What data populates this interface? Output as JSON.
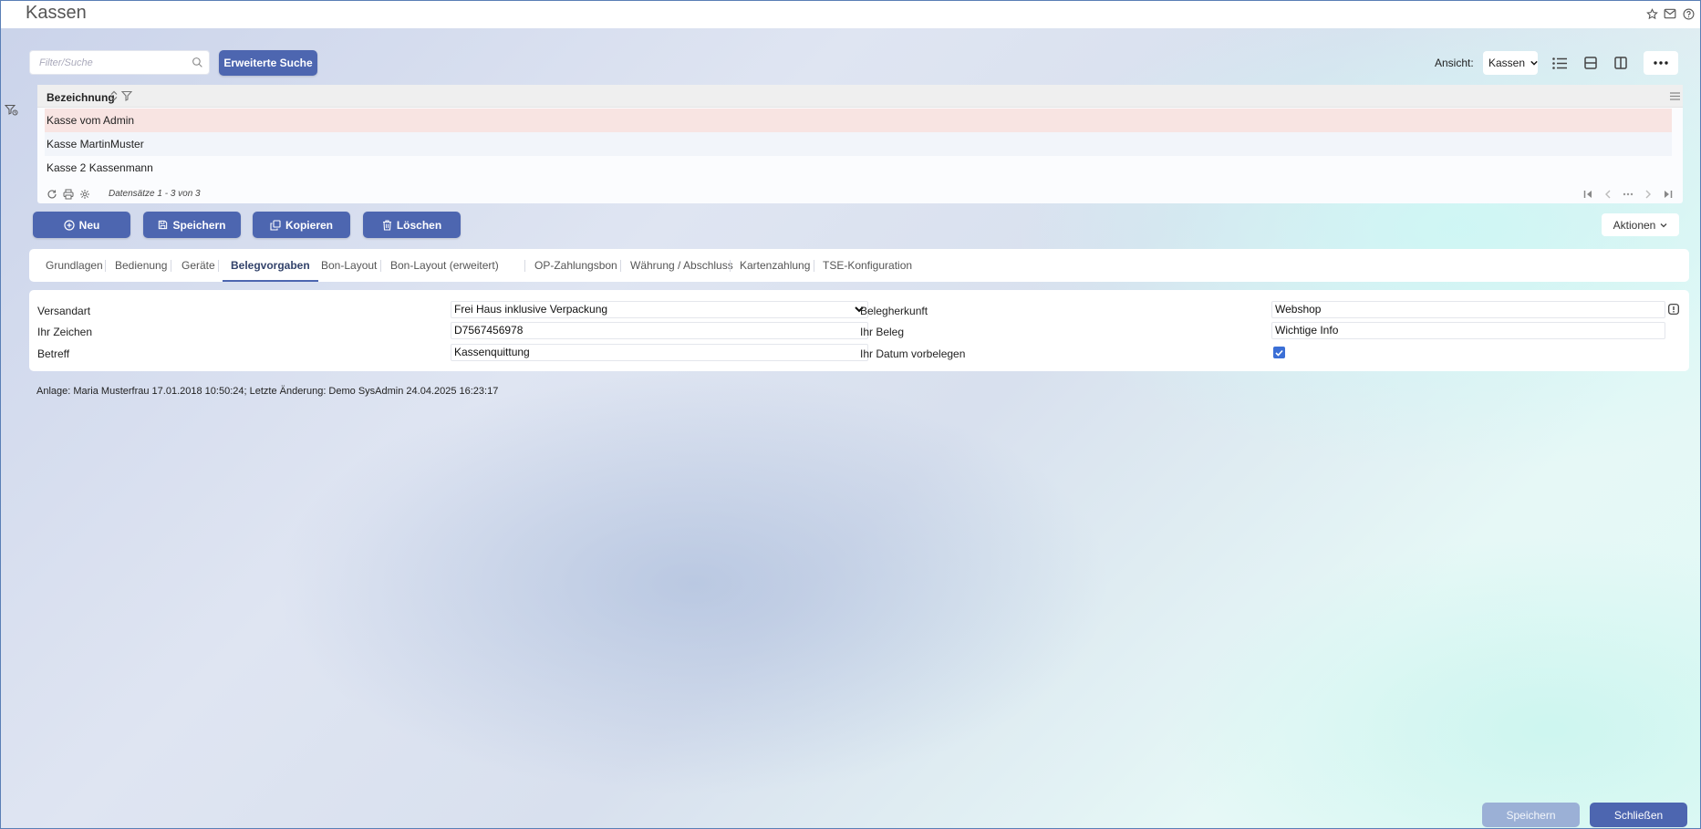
{
  "header": {
    "title": "Kassen"
  },
  "search": {
    "placeholder": "Filter/Suche",
    "extended_label": "Erweiterte Suche"
  },
  "view": {
    "label": "Ansicht:",
    "selected": "Kassen"
  },
  "grid": {
    "column": "Bezeichnung",
    "rows": [
      {
        "name": "Kasse vom Admin",
        "selected": true
      },
      {
        "name": "Kasse MartinMuster",
        "selected": false
      },
      {
        "name": "Kasse 2 Kassenmann",
        "selected": false
      }
    ],
    "record_count": "Datensätze 1 - 3 von 3"
  },
  "actions": {
    "new": "Neu",
    "save": "Speichern",
    "copy": "Kopieren",
    "delete": "Löschen",
    "more": "Aktionen"
  },
  "tabs": [
    "Grundlagen",
    "Bedienung",
    "Geräte",
    "Belegvorgaben",
    "Bon-Layout",
    "Bon-Layout (erweitert)",
    "OP-Zahlungsbon",
    "Währung / Abschluss",
    "Kartenzahlung",
    "TSE-Konfiguration"
  ],
  "active_tab": "Belegvorgaben",
  "form": {
    "versandart_label": "Versandart",
    "versandart_value": "Frei Haus inklusive Verpackung",
    "ihr_zeichen_label": "Ihr Zeichen",
    "ihr_zeichen_value": "D7567456978",
    "betreff_label": "Betreff",
    "betreff_value": "Kassenquittung",
    "belegherkunft_label": "Belegherkunft",
    "belegherkunft_value": "Webshop",
    "ihr_beleg_label": "Ihr Beleg",
    "ihr_beleg_value": "Wichtige Info",
    "ihr_datum_label": "Ihr Datum vorbelegen",
    "ihr_datum_checked": true
  },
  "audit": "Anlage: Maria Musterfrau 17.01.2018 10:50:24; Letzte Änderung: Demo SysAdmin 24.04.2025 16:23:17",
  "footer": {
    "save": "Speichern",
    "close": "Schließen"
  },
  "colors": {
    "primary": "#4d66b0",
    "selected_row": "#f8e4e2",
    "checkbox": "#3b6fd6"
  }
}
